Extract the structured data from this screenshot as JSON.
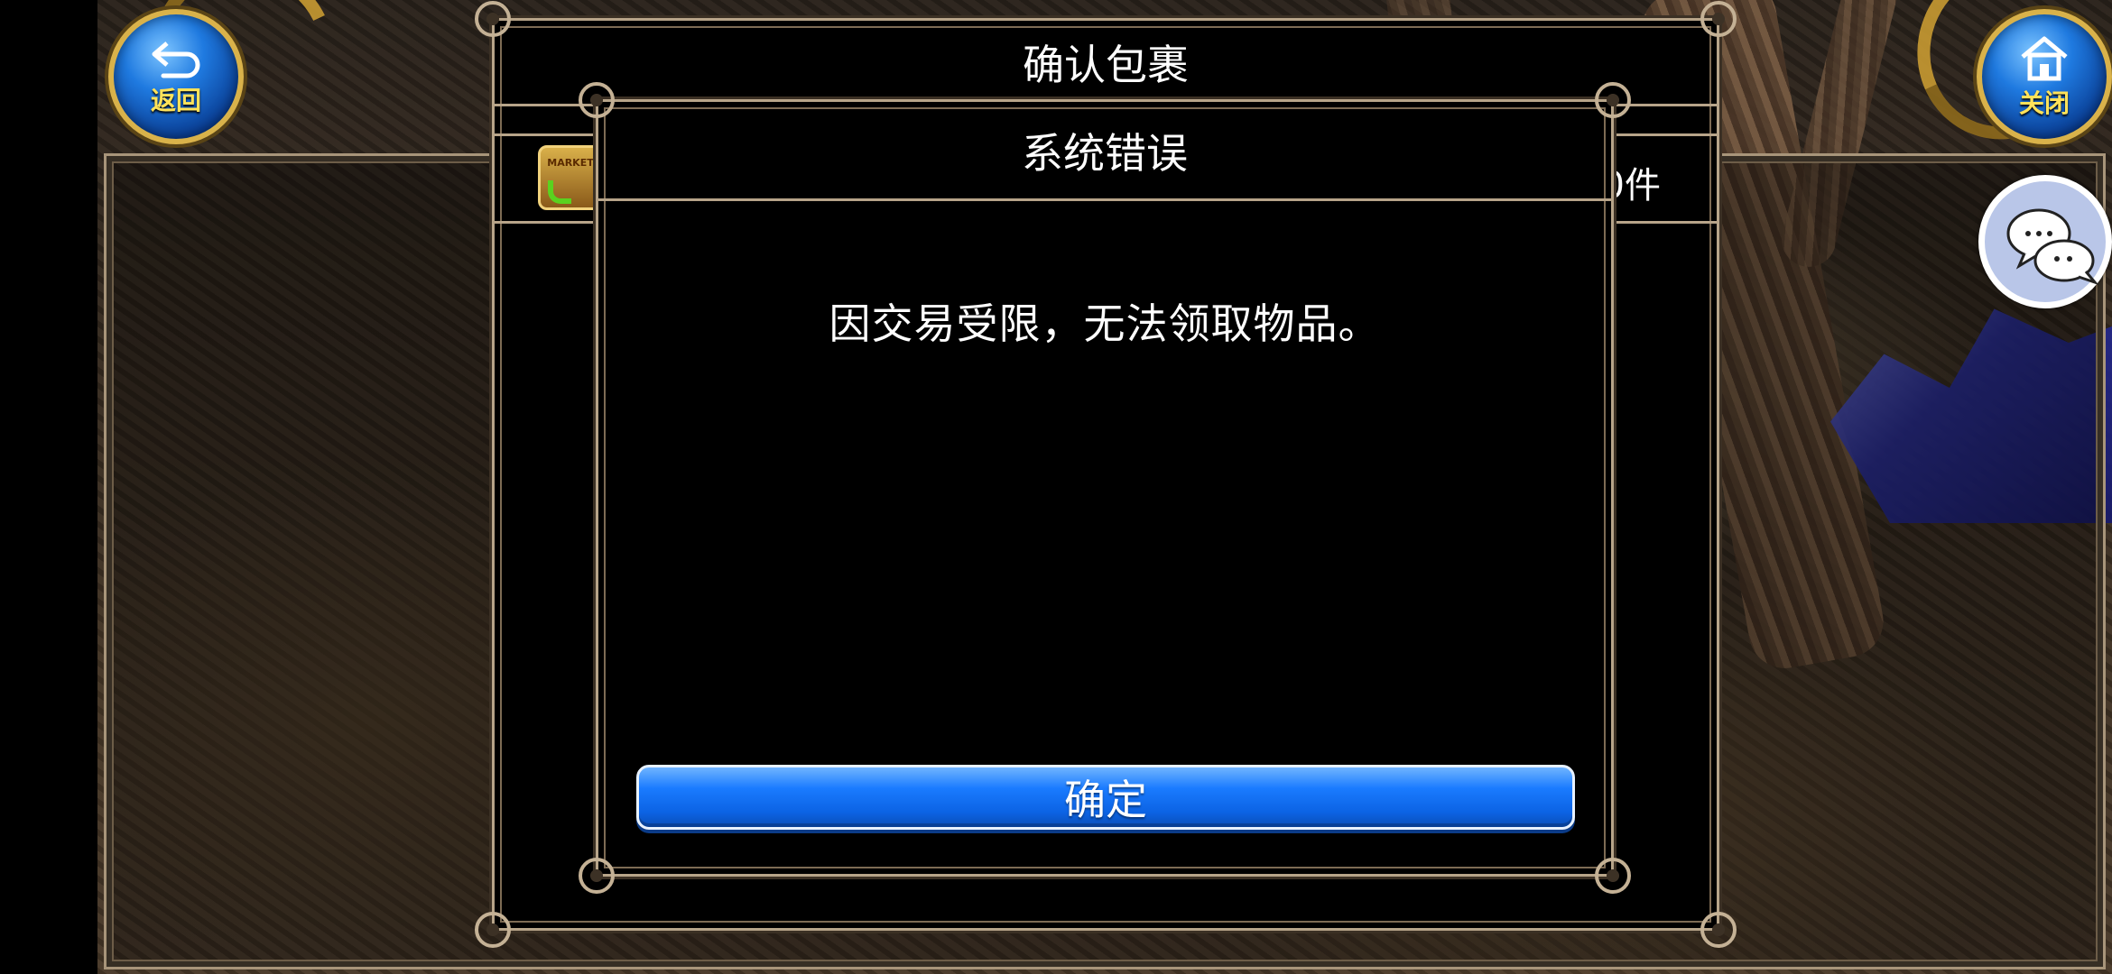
{
  "back_button": {
    "label": "返回",
    "icon": "return-arrow-icon"
  },
  "close_button": {
    "label": "关闭",
    "icon": "home-icon"
  },
  "chat_button": {
    "icon": "chat-bubbles-icon"
  },
  "package_dialog": {
    "title": "确认包裹",
    "item_icon_text": "MARKET",
    "count_fragment": "0件"
  },
  "error_dialog": {
    "title": "系统错误",
    "message": "因交易受限，无法领取物品。",
    "confirm_label": "确定"
  },
  "colors": {
    "button_blue": "#1a7bff",
    "round_label_yellow": "#ffe25a",
    "frame_border": "#b7a489"
  }
}
